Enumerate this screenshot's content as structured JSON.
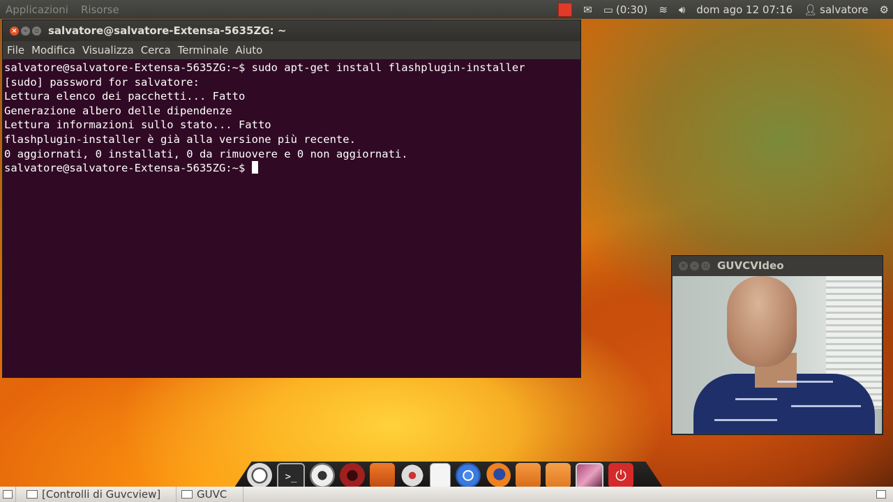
{
  "top_panel": {
    "menus": [
      "Applicazioni",
      "Risorse"
    ],
    "battery": "(0:30)",
    "datetime": "dom ago 12 07:16",
    "user": "salvatore"
  },
  "terminal": {
    "title": "salvatore@salvatore-Extensa-5635ZG: ~",
    "menu": [
      "File",
      "Modifica",
      "Visualizza",
      "Cerca",
      "Terminale",
      "Aiuto"
    ],
    "lines": [
      "salvatore@salvatore-Extensa-5635ZG:~$ sudo apt-get install flashplugin-installer",
      "[sudo] password for salvatore:",
      "Lettura elenco dei pacchetti... Fatto",
      "Generazione albero delle dipendenze",
      "Lettura informazioni sullo stato... Fatto",
      "flashplugin-installer è già alla versione più recente.",
      "0 aggiornati, 0 installati, 0 da rimuovere e 0 non aggiornati."
    ],
    "prompt": "salvatore@salvatore-Extensa-5635ZG:~$ "
  },
  "guvc": {
    "title": "GUVCVIdeo"
  },
  "taskbar": {
    "tasks": [
      "[Controlli di Guvcview]",
      "GUVC"
    ]
  },
  "dock": {
    "icons": [
      "ubuntu-icon",
      "terminal-icon",
      "cheese-icon",
      "recorder-icon",
      "software-center-icon",
      "settings-icon",
      "document-viewer-icon",
      "chrome-icon",
      "firefox-icon",
      "home-folder-icon",
      "files-icon",
      "screen-icon",
      "power-icon"
    ]
  },
  "colors": {
    "terminal_bg": "#300a24",
    "panel_bg": "#3c3b37",
    "close_button": "#e0522a"
  }
}
